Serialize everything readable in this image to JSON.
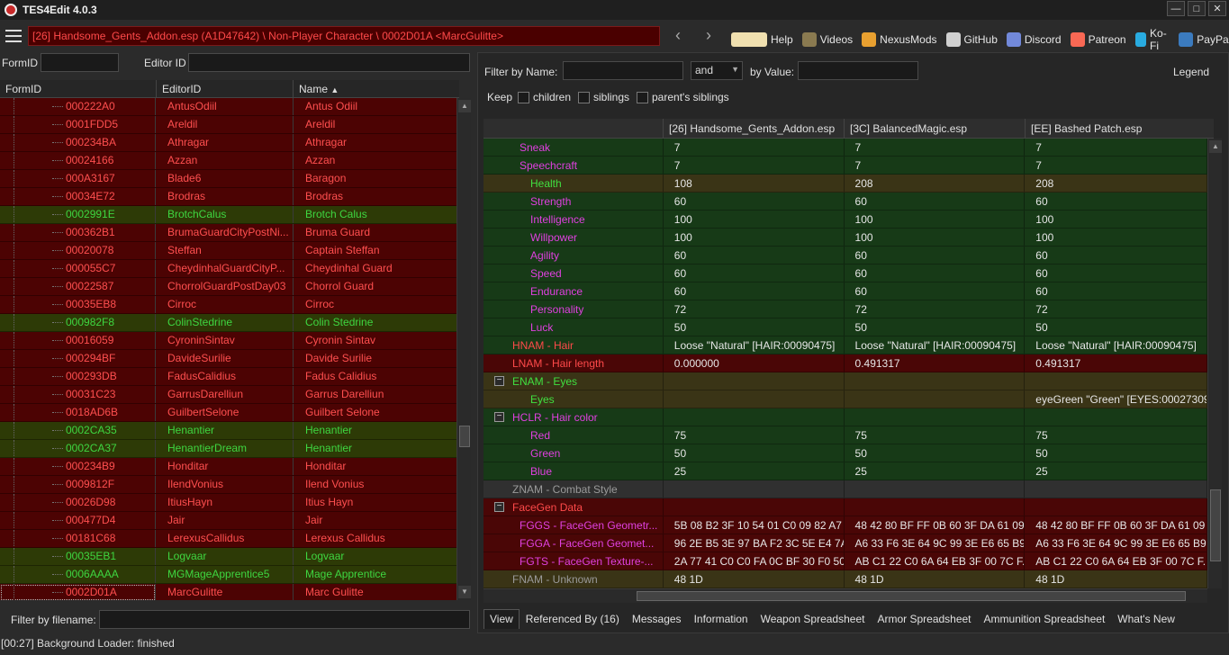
{
  "window": {
    "title": "TES4Edit 4.0.3"
  },
  "toolbar": {
    "path": "[26] Handsome_Gents_Addon.esp (A1D47642) \\ Non-Player Character \\ 0002D01A <MarcGulitte>",
    "links": [
      {
        "label": "Help",
        "icon": "book-icon",
        "color": "#f0e0b0"
      },
      {
        "label": "Videos",
        "icon": "gp-icon",
        "color": "#8a7a50"
      },
      {
        "label": "NexusMods",
        "icon": "nexus-icon",
        "color": "#e8a030"
      },
      {
        "label": "GitHub",
        "icon": "github-icon",
        "color": "#d0d0d0"
      },
      {
        "label": "Discord",
        "icon": "discord-icon",
        "color": "#7289da"
      },
      {
        "label": "Patreon",
        "icon": "patreon-icon",
        "color": "#f96854"
      },
      {
        "label": "Ko-Fi",
        "icon": "kofi-icon",
        "color": "#29abe0"
      },
      {
        "label": "PayPal",
        "icon": "paypal-icon",
        "color": "#3b7bbf"
      }
    ]
  },
  "left": {
    "formid_label": "FormID",
    "editorid_label": "Editor ID",
    "formid_value": "",
    "editorid_value": "",
    "columns": [
      "FormID",
      "EditorID",
      "Name"
    ],
    "rows": [
      {
        "formid": "000222A0",
        "editorid": "AntusOdiil",
        "name": "Antus Odiil",
        "c": "red"
      },
      {
        "formid": "0001FDD5",
        "editorid": "Areldil",
        "name": "Areldil",
        "c": "red"
      },
      {
        "formid": "000234BA",
        "editorid": "Athragar",
        "name": "Athragar",
        "c": "red"
      },
      {
        "formid": "00024166",
        "editorid": "Azzan",
        "name": "Azzan",
        "c": "red"
      },
      {
        "formid": "000A3167",
        "editorid": "Blade6",
        "name": "Baragon",
        "c": "red"
      },
      {
        "formid": "00034E72",
        "editorid": "Brodras",
        "name": "Brodras",
        "c": "red"
      },
      {
        "formid": "0002991E",
        "editorid": "BrotchCalus",
        "name": "Brotch Calus",
        "c": "grn"
      },
      {
        "formid": "000362B1",
        "editorid": "BrumaGuardCityPostNi...",
        "name": "Bruma Guard",
        "c": "red"
      },
      {
        "formid": "00020078",
        "editorid": "Steffan",
        "name": "Captain Steffan",
        "c": "red"
      },
      {
        "formid": "000055C7",
        "editorid": "CheydinhalGuardCityP...",
        "name": "Cheydinhal Guard",
        "c": "red"
      },
      {
        "formid": "00022587",
        "editorid": "ChorrolGuardPostDay03",
        "name": "Chorrol Guard",
        "c": "red"
      },
      {
        "formid": "00035EB8",
        "editorid": "Cirroc",
        "name": "Cirroc",
        "c": "red"
      },
      {
        "formid": "000982F8",
        "editorid": "ColinStedrine",
        "name": "Colin Stedrine",
        "c": "grn"
      },
      {
        "formid": "00016059",
        "editorid": "CyroninSintav",
        "name": "Cyronin Sintav",
        "c": "red"
      },
      {
        "formid": "000294BF",
        "editorid": "DavideSurilie",
        "name": "Davide Surilie",
        "c": "red"
      },
      {
        "formid": "000293DB",
        "editorid": "FadusCalidius",
        "name": "Fadus Calidius",
        "c": "red"
      },
      {
        "formid": "00031C23",
        "editorid": "GarrusDarelliun",
        "name": "Garrus Darelliun",
        "c": "red"
      },
      {
        "formid": "0018AD6B",
        "editorid": "GuilbertSelone",
        "name": "Guilbert Selone",
        "c": "red"
      },
      {
        "formid": "0002CA35",
        "editorid": "Henantier",
        "name": "Henantier",
        "c": "grn"
      },
      {
        "formid": "0002CA37",
        "editorid": "HenantierDream",
        "name": "Henantier",
        "c": "grn"
      },
      {
        "formid": "000234B9",
        "editorid": "Honditar",
        "name": "Honditar",
        "c": "red"
      },
      {
        "formid": "0009812F",
        "editorid": "IlendVonius",
        "name": "Ilend Vonius",
        "c": "red"
      },
      {
        "formid": "00026D98",
        "editorid": "ItiusHayn",
        "name": "Itius Hayn",
        "c": "red"
      },
      {
        "formid": "000477D4",
        "editorid": "Jair",
        "name": "Jair",
        "c": "red"
      },
      {
        "formid": "00181C68",
        "editorid": "LerexusCallidus",
        "name": "Lerexus Callidus",
        "c": "red"
      },
      {
        "formid": "00035EB1",
        "editorid": "Logvaar",
        "name": "Logvaar",
        "c": "grn"
      },
      {
        "formid": "0006AAAA",
        "editorid": "MGMageApprentice5",
        "name": "Mage Apprentice",
        "c": "grn"
      },
      {
        "formid": "0002D01A",
        "editorid": "MarcGulitte",
        "name": "Marc Gulitte",
        "c": "red"
      }
    ],
    "filter_label": "Filter by filename:",
    "filter_value": ""
  },
  "right": {
    "filter_name_label": "Filter by Name:",
    "filter_name_value": "",
    "and_value": "and",
    "by_value_label": "by Value:",
    "by_value_value": "",
    "legend": "Legend",
    "keep_label": "Keep",
    "keep_children": "children",
    "keep_siblings": "siblings",
    "keep_parents": "parent's siblings",
    "columns": [
      "",
      "[26] Handsome_Gents_Addon.esp",
      "[3C] BalancedMagic.esp",
      "[EE] Bashed Patch.esp"
    ],
    "rows": [
      {
        "name": "Sneak",
        "v1": "7",
        "v2": "7",
        "v3": "7"
      },
      {
        "name": "Speechcraft",
        "v1": "7",
        "v2": "7",
        "v3": "7"
      },
      {
        "name": "Health",
        "v1": "108",
        "v2": "208",
        "v3": "208"
      },
      {
        "name": "Strength",
        "v1": "60",
        "v2": "60",
        "v3": "60"
      },
      {
        "name": "Intelligence",
        "v1": "100",
        "v2": "100",
        "v3": "100"
      },
      {
        "name": "Willpower",
        "v1": "100",
        "v2": "100",
        "v3": "100"
      },
      {
        "name": "Agility",
        "v1": "60",
        "v2": "60",
        "v3": "60"
      },
      {
        "name": "Speed",
        "v1": "60",
        "v2": "60",
        "v3": "60"
      },
      {
        "name": "Endurance",
        "v1": "60",
        "v2": "60",
        "v3": "60"
      },
      {
        "name": "Personality",
        "v1": "72",
        "v2": "72",
        "v3": "72"
      },
      {
        "name": "Luck",
        "v1": "50",
        "v2": "50",
        "v3": "50"
      },
      {
        "name": "HNAM - Hair",
        "v1": "Loose \"Natural\" [HAIR:00090475]",
        "v2": "Loose \"Natural\" [HAIR:00090475]",
        "v3": "Loose \"Natural\" [HAIR:00090475]"
      },
      {
        "name": "LNAM - Hair length",
        "v1": "0.000000",
        "v2": "0.491317",
        "v3": "0.491317"
      },
      {
        "name": "ENAM - Eyes",
        "v1": "",
        "v2": "",
        "v3": ""
      },
      {
        "name": "Eyes",
        "v1": "",
        "v2": "",
        "v3": "eyeGreen \"Green\" [EYES:00027309]"
      },
      {
        "name": "HCLR - Hair color",
        "v1": "",
        "v2": "",
        "v3": ""
      },
      {
        "name": "Red",
        "v1": "75",
        "v2": "75",
        "v3": "75"
      },
      {
        "name": "Green",
        "v1": "50",
        "v2": "50",
        "v3": "50"
      },
      {
        "name": "Blue",
        "v1": "25",
        "v2": "25",
        "v3": "25"
      },
      {
        "name": "ZNAM - Combat Style",
        "v1": "",
        "v2": "",
        "v3": ""
      },
      {
        "name": "FaceGen Data",
        "v1": "",
        "v2": "",
        "v3": ""
      },
      {
        "name": "FGGS - FaceGen Geometr...",
        "v1": "5B 08 B2 3F 10 54 01 C0 09 82 A7 ...",
        "v2": "48 42 80 BF FF 0B 60 3F DA 61 09 ...",
        "v3": "48 42 80 BF FF 0B 60 3F DA 61 09 ..."
      },
      {
        "name": "FGGA - FaceGen Geomet...",
        "v1": "96 2E B5 3E 97 BA F2 3C 5E E4 7A ...",
        "v2": "A6 33 F6 3E 64 9C 99 3E E6 65 B9 ...",
        "v3": "A6 33 F6 3E 64 9C 99 3E E6 65 B9 ..."
      },
      {
        "name": "FGTS - FaceGen Texture-...",
        "v1": "2A 77 41 C0 C0 FA 0C BF 30 F0 50...",
        "v2": "AB C1 22 C0 6A 64 EB 3F 00 7C F...",
        "v3": "AB C1 22 C0 6A 64 EB 3F 00 7C F..."
      },
      {
        "name": "FNAM - Unknown",
        "v1": "48 1D",
        "v2": "48 1D",
        "v3": "48 1D"
      }
    ],
    "tabs": [
      "View",
      "Referenced By (16)",
      "Messages",
      "Information",
      "Weapon Spreadsheet",
      "Armor Spreadsheet",
      "Ammunition Spreadsheet",
      "What's New"
    ]
  },
  "status": "[00:27] Background Loader: finished"
}
